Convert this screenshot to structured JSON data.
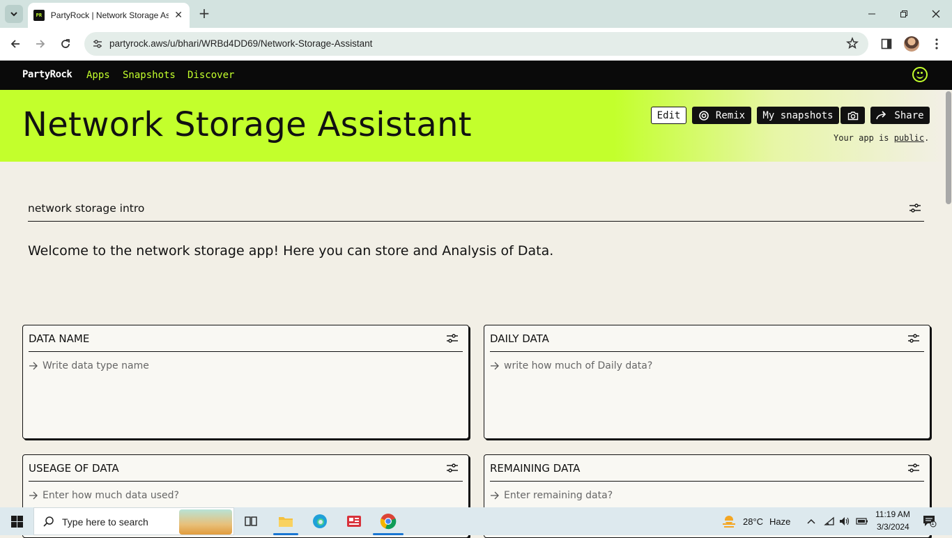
{
  "browser": {
    "tab_title": "PartyRock | Network Storage Assistant",
    "tab_favicon_text": "PR",
    "url": "partyrock.aws/u/bhari/WRBd4DD69/Network-Storage-Assistant"
  },
  "nav": {
    "logo": "PartyRock",
    "links": [
      "Apps",
      "Snapshots",
      "Discover"
    ]
  },
  "hero": {
    "title": "Network Storage Assistant",
    "edit_label": "Edit",
    "remix_label": "Remix",
    "snapshots_label": "My snapshots",
    "share_label": "Share",
    "public_prefix": "Your app is ",
    "public_link": "public",
    "public_suffix": "."
  },
  "intro": {
    "title": "network storage intro",
    "text": "Welcome to the network storage app! Here you can store and Analysis of Data."
  },
  "widgets": [
    {
      "title": "DATA NAME",
      "placeholder": "Write data type name"
    },
    {
      "title": "DAILY DATA",
      "placeholder": "write how much of Daily data?"
    },
    {
      "title": "USEAGE OF DATA",
      "placeholder": "Enter how much data used?"
    },
    {
      "title": "REMAINING DATA",
      "placeholder": "Enter remaining data?"
    }
  ],
  "taskbar": {
    "search_placeholder": "Type here to search",
    "weather_temp": "28°C",
    "weather_desc": "Haze",
    "time": "11:19 AM",
    "date": "3/3/2024",
    "notification_count": "1"
  },
  "colors": {
    "accent": "#c3ff2c",
    "nav_bg": "#0a0a0a",
    "page_bg": "#f2efe6"
  }
}
